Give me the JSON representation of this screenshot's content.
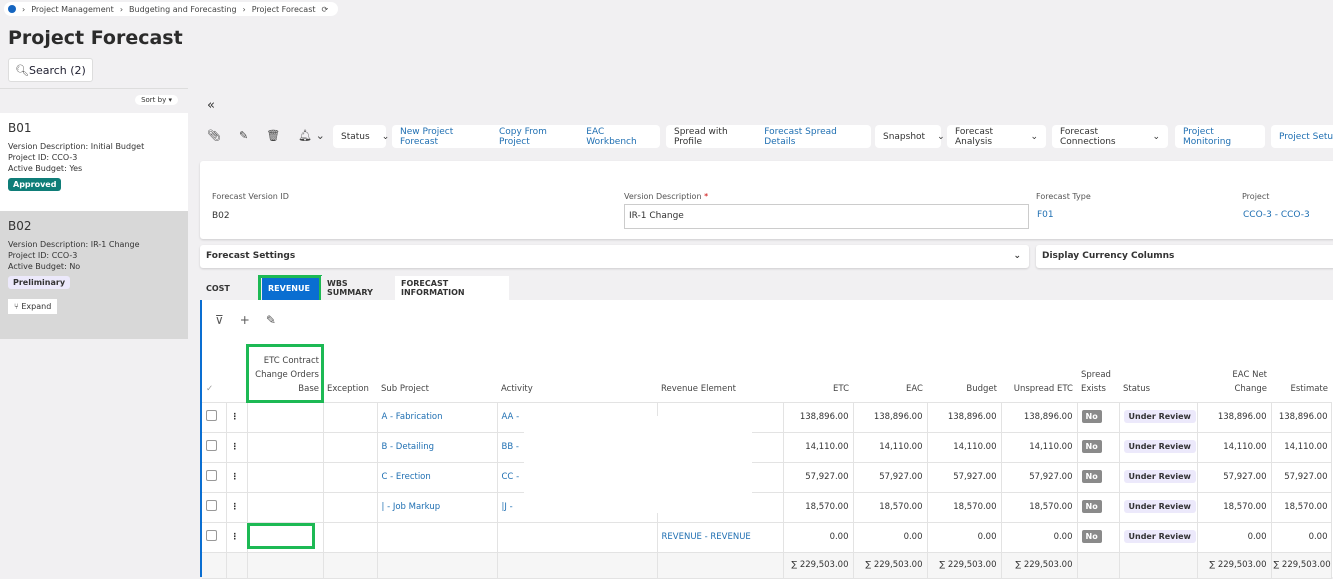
{
  "breadcrumb": [
    "Project Management",
    "Budgeting and Forecasting",
    "Project Forecast"
  ],
  "page_title": "Project Forecast",
  "search_label": "Search (2)",
  "sort_label": "Sort by",
  "versions": [
    {
      "id": "B01",
      "desc_label": "Version Description:",
      "desc": "Initial Budget",
      "pid_label": "Project ID:",
      "pid": "CCO-3",
      "active_label": "Active Budget:",
      "active": "Yes",
      "status": "Approved"
    },
    {
      "id": "B02",
      "desc_label": "Version Description:",
      "desc": "IR-1 Change",
      "pid_label": "Project ID:",
      "pid": "CCO-3",
      "active_label": "Active Budget:",
      "active": "No",
      "status": "Preliminary"
    }
  ],
  "expand_label": "Expand",
  "toolbar": {
    "status": "Status",
    "new": "New Project Forecast",
    "copy": "Copy From Project",
    "eac": "EAC Workbench",
    "spread": "Spread with Profile",
    "spread_details": "Forecast Spread Details",
    "snapshot": "Snapshot",
    "analysis": "Forecast Analysis",
    "connections": "Forecast Connections",
    "monitoring": "Project Monitoring",
    "setup": "Project Setup"
  },
  "form": {
    "fvid_label": "Forecast Version ID",
    "fvid": "B02",
    "vdesc_label": "Version Description",
    "vdesc": "IR-1 Change",
    "ftype_label": "Forecast Type",
    "ftype": "F01",
    "project_label": "Project",
    "project": "CCO-3 - CCO-3"
  },
  "settings": {
    "forecast_settings": "Forecast Settings",
    "currency_columns": "Display Currency Columns"
  },
  "tabs": [
    "COST",
    "REVENUE",
    "WBS SUMMARY",
    "FORECAST INFORMATION"
  ],
  "columns": [
    "ETC Contract Change Orders Base",
    "Exception",
    "Sub Project",
    "Activity",
    "Revenue Element",
    "ETC",
    "EAC",
    "Budget",
    "Unspread ETC",
    "Spread Exists",
    "Status",
    "EAC Net Change",
    "Estimate"
  ],
  "rows": [
    {
      "sub": "A - Fabrication",
      "act": "AA -",
      "rev": "",
      "etc": "138,896.00",
      "eac": "138,896.00",
      "budget": "138,896.00",
      "unspread": "138,896.00",
      "spread": "No",
      "status": "Under Review",
      "net": "138,896.00",
      "est": "138,896.00"
    },
    {
      "sub": "B - Detailing",
      "act": "BB -",
      "rev": "",
      "etc": "14,110.00",
      "eac": "14,110.00",
      "budget": "14,110.00",
      "unspread": "14,110.00",
      "spread": "No",
      "status": "Under Review",
      "net": "14,110.00",
      "est": "14,110.00"
    },
    {
      "sub": "C - Erection",
      "act": "CC -",
      "rev": "",
      "etc": "57,927.00",
      "eac": "57,927.00",
      "budget": "57,927.00",
      "unspread": "57,927.00",
      "spread": "No",
      "status": "Under Review",
      "net": "57,927.00",
      "est": "57,927.00"
    },
    {
      "sub": "| - Job Markup",
      "act": "|J -",
      "rev": "",
      "etc": "18,570.00",
      "eac": "18,570.00",
      "budget": "18,570.00",
      "unspread": "18,570.00",
      "spread": "No",
      "status": "Under Review",
      "net": "18,570.00",
      "est": "18,570.00"
    },
    {
      "sub": "",
      "act": "",
      "rev": "REVENUE - REVENUE",
      "etc": "0.00",
      "eac": "0.00",
      "budget": "0.00",
      "unspread": "0.00",
      "spread": "No",
      "status": "Under Review",
      "net": "0.00",
      "est": "0.00"
    }
  ],
  "totals": {
    "etc": "∑ 229,503.00",
    "eac": "∑ 229,503.00",
    "budget": "∑ 229,503.00",
    "unspread": "∑ 229,503.00",
    "net": "∑ 229,503.00",
    "est": "∑ 229,503.00"
  }
}
